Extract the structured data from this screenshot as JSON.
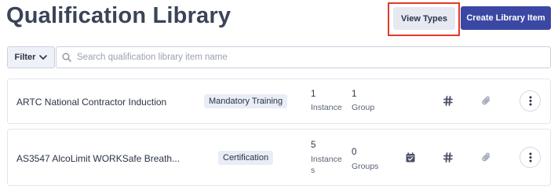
{
  "page": {
    "title": "Qualification Library",
    "view_types_label": "View Types",
    "create_item_label": "Create Library Item"
  },
  "filter": {
    "label": "Filter",
    "search_placeholder": "Search qualification library item name"
  },
  "items": [
    {
      "name": "ARTC National Contractor Induction",
      "type": "Mandatory Training",
      "instance_count": "1",
      "instance_label": "Instance",
      "group_count": "1",
      "group_label": "Group",
      "icons": [
        "hash-icon",
        "paperclip-icon"
      ]
    },
    {
      "name": "AS3547 AlcoLimit WORKSafe Breath...",
      "type": "Certification",
      "instance_count": "5",
      "instance_label_line1": "Instance",
      "instance_label_line2": "s",
      "group_count": "0",
      "group_label": "Groups",
      "icons": [
        "calendar-check-icon",
        "hash-icon",
        "paperclip-icon"
      ]
    }
  ],
  "colors": {
    "primary": "#3b48a3",
    "highlight": "#e0392b",
    "badge_bg": "#e9edf5",
    "icon": "#4a5164"
  }
}
